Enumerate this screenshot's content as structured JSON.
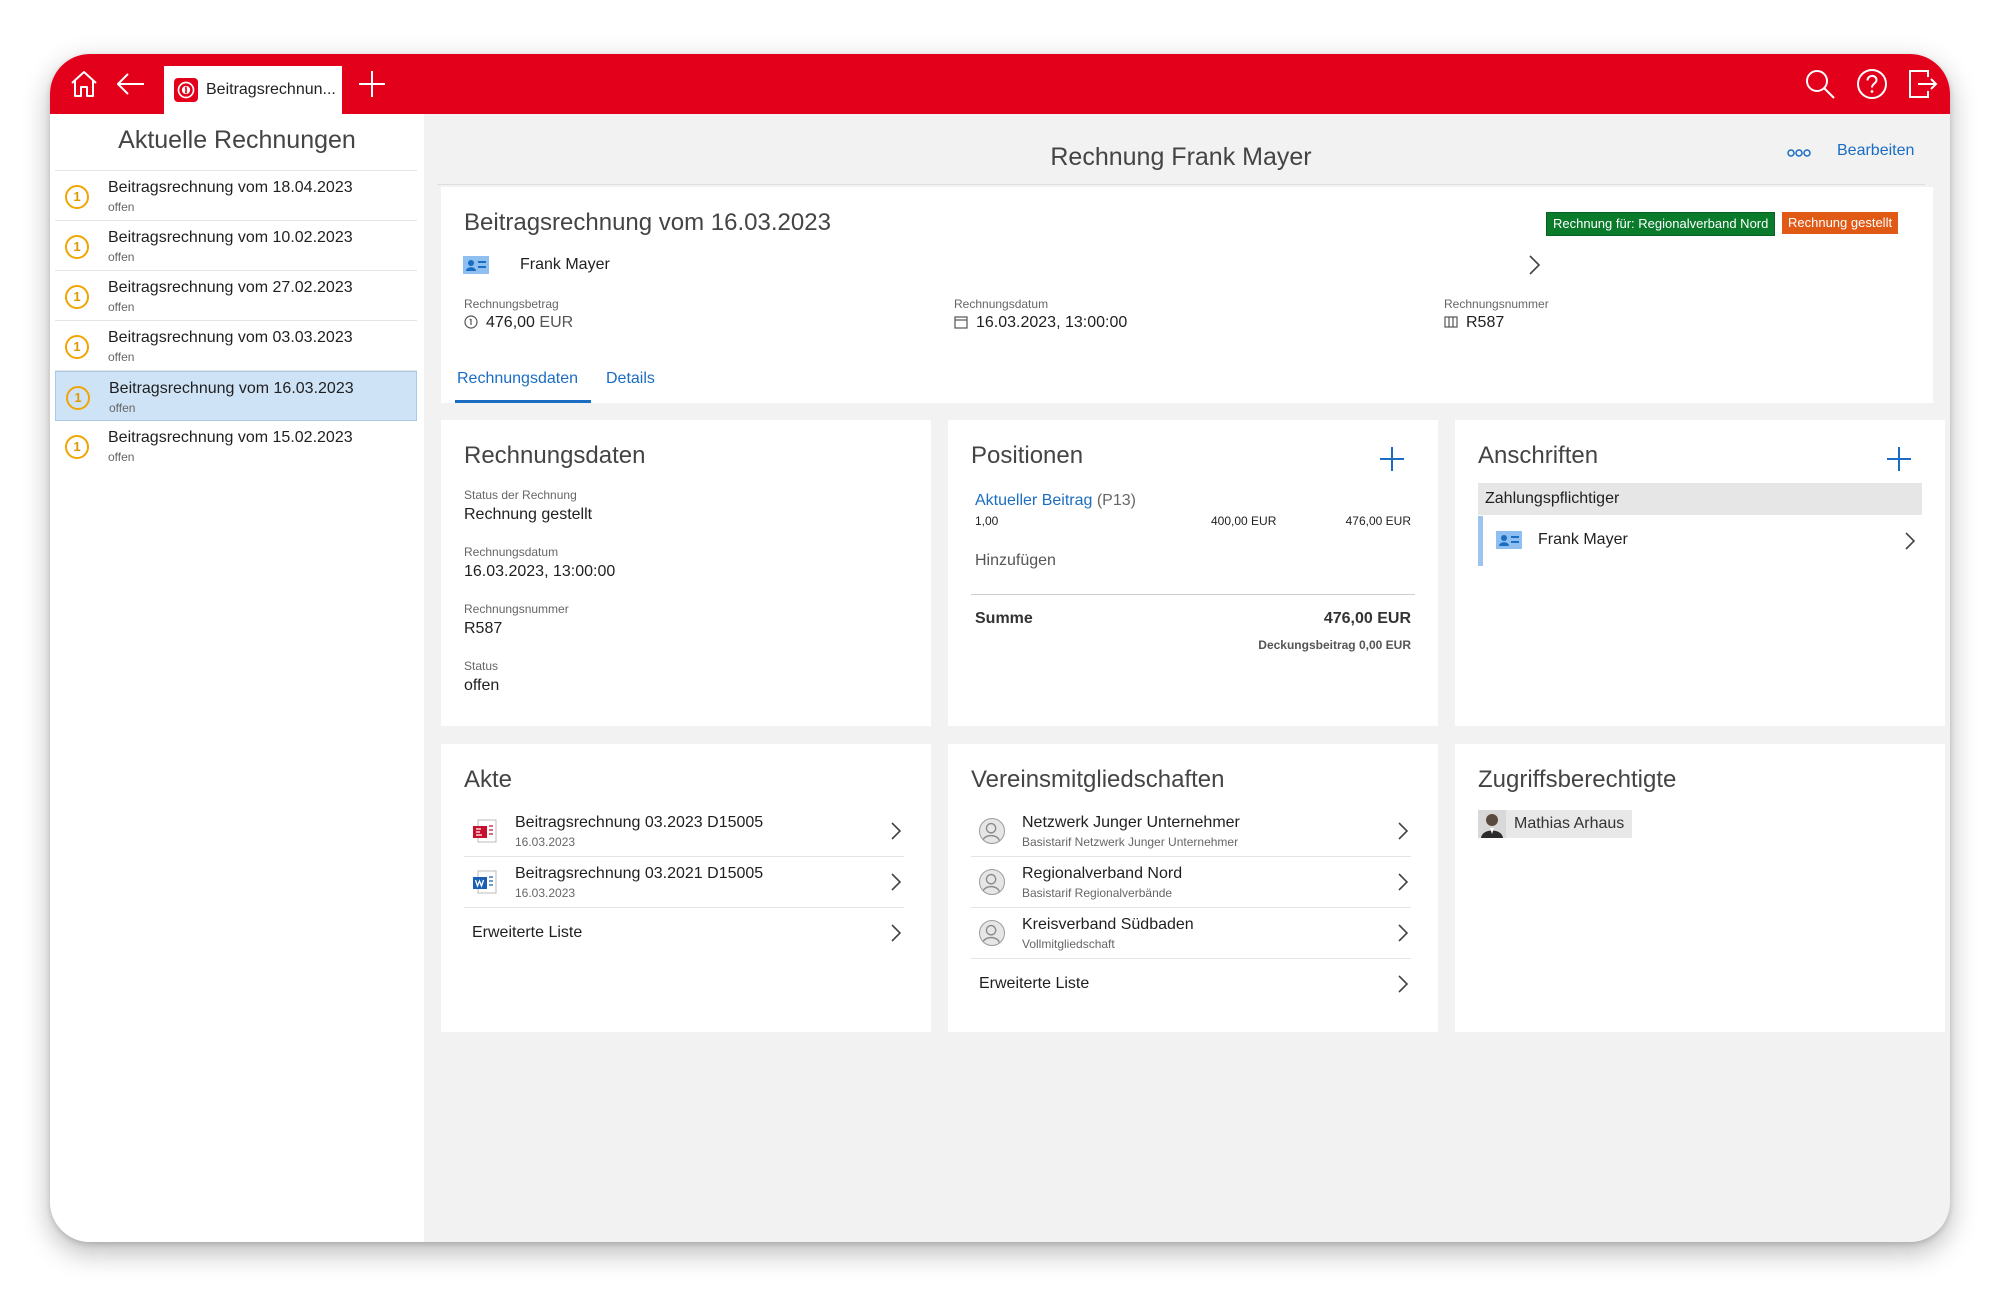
{
  "topbar": {
    "tab_label": "Beitragsrechnun...",
    "icons": [
      "home-icon",
      "back-arrow-icon",
      "add-tab-icon",
      "search-icon",
      "help-icon",
      "logout-icon"
    ],
    "brand_color": "#e3001b"
  },
  "sidebar": {
    "title": "Aktuelle Rechnungen",
    "items": [
      {
        "badge": "1",
        "label": "Beitragsrechnung vom 18.04.2023",
        "status": "offen"
      },
      {
        "badge": "1",
        "label": "Beitragsrechnung vom 10.02.2023",
        "status": "offen"
      },
      {
        "badge": "1",
        "label": "Beitragsrechnung vom 27.02.2023",
        "status": "offen"
      },
      {
        "badge": "1",
        "label": "Beitragsrechnung vom 03.03.2023",
        "status": "offen"
      },
      {
        "badge": "1",
        "label": "Beitragsrechnung vom 16.03.2023",
        "status": "offen"
      },
      {
        "badge": "1",
        "label": "Beitragsrechnung vom 15.02.2023",
        "status": "offen"
      }
    ],
    "selected_index": 4
  },
  "main": {
    "title": "Rechnung Frank Mayer",
    "edit_label": "Bearbeiten"
  },
  "header": {
    "title": "Beitragsrechnung vom 16.03.2023",
    "badge_recipient": "Rechnung für: Regionalverband Nord",
    "badge_status": "Rechnung gestellt",
    "person": "Frank Mayer",
    "fields": {
      "amount_label": "Rechnungsbetrag",
      "amount_value": "476,00",
      "amount_currency": "EUR",
      "date_label": "Rechnungsdatum",
      "date_value": "16.03.2023, 13:00:00",
      "number_label": "Rechnungsnummer",
      "number_value": "R587"
    },
    "tabs": [
      "Rechnungsdaten",
      "Details"
    ]
  },
  "rechnungsdaten": {
    "title": "Rechnungsdaten",
    "status_label": "Status der Rechnung",
    "status_value": "Rechnung gestellt",
    "date_label": "Rechnungsdatum",
    "date_value": "16.03.2023, 13:00:00",
    "number_label": "Rechnungsnummer",
    "number_value": "R587",
    "state_label": "Status",
    "state_value": "offen"
  },
  "positionen": {
    "title": "Positionen",
    "item_name": "Aktueller Beitrag",
    "item_code": "(P13)",
    "item_qty": "1,00",
    "item_price": "400,00 EUR",
    "item_total": "476,00 EUR",
    "add_label": "Hinzufügen",
    "sum_label": "Summe",
    "sum_value": "476,00 EUR",
    "coverage": "Deckungsbeitrag 0,00 EUR"
  },
  "anschriften": {
    "title": "Anschriften",
    "group": "Zahlungspflichtiger",
    "person": "Frank Mayer"
  },
  "akte": {
    "title": "Akte",
    "items": [
      {
        "name": "Beitragsrechnung 03.2023 D15005",
        "date": "16.03.2023",
        "type": "pdf-file-icon"
      },
      {
        "name": "Beitragsrechnung 03.2021 D15005",
        "date": "16.03.2023",
        "type": "word-file-icon"
      }
    ],
    "extended": "Erweiterte Liste"
  },
  "vereinsmitgliedschaften": {
    "title": "Vereinsmitgliedschaften",
    "items": [
      {
        "name": "Netzwerk Junger Unternehmer",
        "sub": "Basistarif Netzwerk Junger Unternehmer"
      },
      {
        "name": "Regionalverband Nord",
        "sub": "Basistarif Regionalverbände"
      },
      {
        "name": "Kreisverband Südbaden",
        "sub": "Vollmitgliedschaft"
      }
    ],
    "extended": "Erweiterte Liste"
  },
  "zugriffsberechtigte": {
    "title": "Zugriffsberechtigte",
    "person": "Mathias Arhaus"
  },
  "colors": {
    "accent": "#1a6dc2",
    "badge_green": "#0a7a2b",
    "badge_orange": "#e05a16",
    "pending": "#f0a500"
  }
}
